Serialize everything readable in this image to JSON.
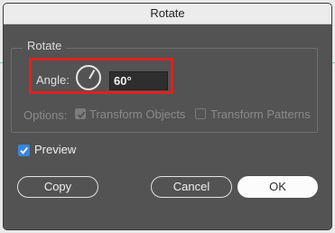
{
  "dialog": {
    "title": "Rotate"
  },
  "rotate_group": {
    "title": "Rotate",
    "angle_label": "Angle:",
    "angle_value": "60°",
    "dial_icon": "angle-dial-icon"
  },
  "options": {
    "label": "Options:",
    "transform_objects": {
      "label": "Transform Objects",
      "checked": true,
      "enabled": false
    },
    "transform_patterns": {
      "label": "Transform Patterns",
      "checked": false,
      "enabled": false
    }
  },
  "preview": {
    "label": "Preview",
    "checked": true
  },
  "buttons": {
    "copy": "Copy",
    "cancel": "Cancel",
    "ok": "OK"
  },
  "colors": {
    "dialog_bg": "#535353",
    "highlight": "#e02020",
    "checkbox_accent": "#3a86de",
    "primary_button": "#fcfcfc"
  }
}
